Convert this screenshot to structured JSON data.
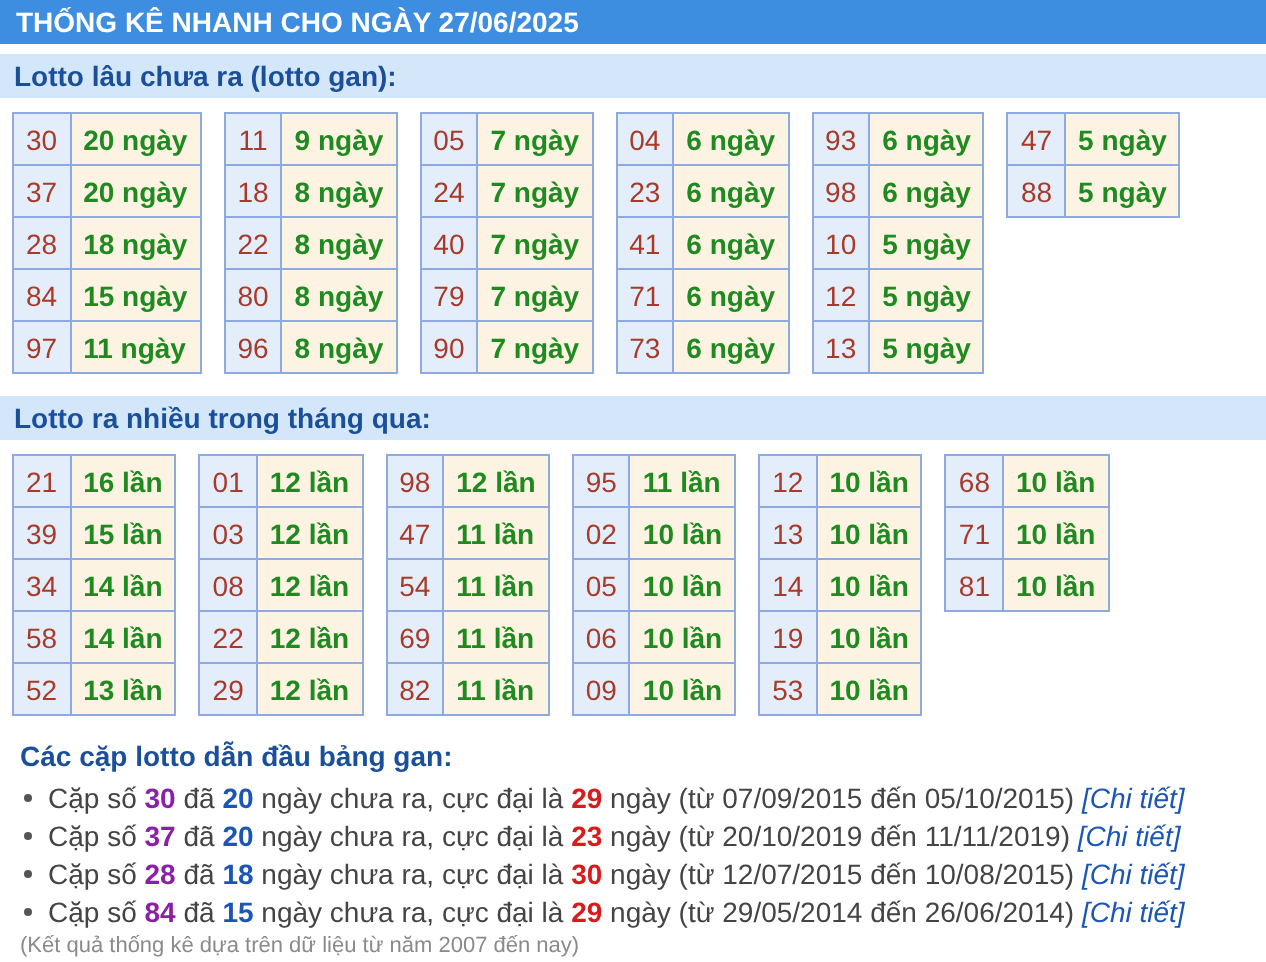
{
  "title": "THỐNG KÊ NHANH CHO NGÀY 27/06/2025",
  "sections": [
    {
      "heading": "Lotto lâu chưa ra (lotto gan):",
      "tables": [
        [
          {
            "number": "30",
            "value": "20 ngày"
          },
          {
            "number": "37",
            "value": "20 ngày"
          },
          {
            "number": "28",
            "value": "18 ngày"
          },
          {
            "number": "84",
            "value": "15 ngày"
          },
          {
            "number": "97",
            "value": "11 ngày"
          }
        ],
        [
          {
            "number": "11",
            "value": "9 ngày"
          },
          {
            "number": "18",
            "value": "8 ngày"
          },
          {
            "number": "22",
            "value": "8 ngày"
          },
          {
            "number": "80",
            "value": "8 ngày"
          },
          {
            "number": "96",
            "value": "8 ngày"
          }
        ],
        [
          {
            "number": "05",
            "value": "7 ngày"
          },
          {
            "number": "24",
            "value": "7 ngày"
          },
          {
            "number": "40",
            "value": "7 ngày"
          },
          {
            "number": "79",
            "value": "7 ngày"
          },
          {
            "number": "90",
            "value": "7 ngày"
          }
        ],
        [
          {
            "number": "04",
            "value": "6 ngày"
          },
          {
            "number": "23",
            "value": "6 ngày"
          },
          {
            "number": "41",
            "value": "6 ngày"
          },
          {
            "number": "71",
            "value": "6 ngày"
          },
          {
            "number": "73",
            "value": "6 ngày"
          }
        ],
        [
          {
            "number": "93",
            "value": "6 ngày"
          },
          {
            "number": "98",
            "value": "6 ngày"
          },
          {
            "number": "10",
            "value": "5 ngày"
          },
          {
            "number": "12",
            "value": "5 ngày"
          },
          {
            "number": "13",
            "value": "5 ngày"
          }
        ],
        [
          {
            "number": "47",
            "value": "5 ngày"
          },
          {
            "number": "88",
            "value": "5 ngày"
          }
        ]
      ]
    },
    {
      "heading": "Lotto ra nhiều trong tháng qua:",
      "tables": [
        [
          {
            "number": "21",
            "value": "16 lần"
          },
          {
            "number": "39",
            "value": "15 lần"
          },
          {
            "number": "34",
            "value": "14 lần"
          },
          {
            "number": "58",
            "value": "14 lần"
          },
          {
            "number": "52",
            "value": "13 lần"
          }
        ],
        [
          {
            "number": "01",
            "value": "12 lần"
          },
          {
            "number": "03",
            "value": "12 lần"
          },
          {
            "number": "08",
            "value": "12 lần"
          },
          {
            "number": "22",
            "value": "12 lần"
          },
          {
            "number": "29",
            "value": "12 lần"
          }
        ],
        [
          {
            "number": "98",
            "value": "12 lần"
          },
          {
            "number": "47",
            "value": "11 lần"
          },
          {
            "number": "54",
            "value": "11 lần"
          },
          {
            "number": "69",
            "value": "11 lần"
          },
          {
            "number": "82",
            "value": "11 lần"
          }
        ],
        [
          {
            "number": "95",
            "value": "11 lần"
          },
          {
            "number": "02",
            "value": "10 lần"
          },
          {
            "number": "05",
            "value": "10 lần"
          },
          {
            "number": "06",
            "value": "10 lần"
          },
          {
            "number": "09",
            "value": "10 lần"
          }
        ],
        [
          {
            "number": "12",
            "value": "10 lần"
          },
          {
            "number": "13",
            "value": "10 lần"
          },
          {
            "number": "14",
            "value": "10 lần"
          },
          {
            "number": "19",
            "value": "10 lần"
          },
          {
            "number": "53",
            "value": "10 lần"
          }
        ],
        [
          {
            "number": "68",
            "value": "10 lần"
          },
          {
            "number": "71",
            "value": "10 lần"
          },
          {
            "number": "81",
            "value": "10 lần"
          }
        ]
      ]
    }
  ],
  "summary": {
    "heading": "Các cặp lotto dẫn đầu bảng gan:",
    "items": [
      {
        "segments": [
          {
            "kind": "text",
            "text": "Cặp số "
          },
          {
            "kind": "pair",
            "text": "30"
          },
          {
            "kind": "text",
            "text": " đã "
          },
          {
            "kind": "days",
            "text": "20"
          },
          {
            "kind": "text",
            "text": " ngày chưa ra, cực đại là "
          },
          {
            "kind": "max",
            "text": "29"
          },
          {
            "kind": "text",
            "text": " ngày (từ 07/09/2015 đến 05/10/2015) "
          }
        ],
        "link": "[Chi tiết]"
      },
      {
        "segments": [
          {
            "kind": "text",
            "text": "Cặp số "
          },
          {
            "kind": "pair",
            "text": "37"
          },
          {
            "kind": "text",
            "text": " đã "
          },
          {
            "kind": "days",
            "text": "20"
          },
          {
            "kind": "text",
            "text": " ngày chưa ra, cực đại là "
          },
          {
            "kind": "max",
            "text": "23"
          },
          {
            "kind": "text",
            "text": " ngày (từ 20/10/2019 đến 11/11/2019) "
          }
        ],
        "link": "[Chi tiết]"
      },
      {
        "segments": [
          {
            "kind": "text",
            "text": "Cặp số "
          },
          {
            "kind": "pair",
            "text": "28"
          },
          {
            "kind": "text",
            "text": " đã "
          },
          {
            "kind": "days",
            "text": "18"
          },
          {
            "kind": "text",
            "text": " ngày chưa ra, cực đại là "
          },
          {
            "kind": "max",
            "text": "30"
          },
          {
            "kind": "text",
            "text": " ngày (từ 12/07/2015 đến 10/08/2015) "
          }
        ],
        "link": "[Chi tiết]"
      },
      {
        "segments": [
          {
            "kind": "text",
            "text": "Cặp số "
          },
          {
            "kind": "pair",
            "text": "84"
          },
          {
            "kind": "text",
            "text": " đã "
          },
          {
            "kind": "days",
            "text": "15"
          },
          {
            "kind": "text",
            "text": " ngày chưa ra, cực đại là "
          },
          {
            "kind": "max",
            "text": "29"
          },
          {
            "kind": "text",
            "text": " ngày (từ 29/05/2014 đến 26/06/2014) "
          }
        ],
        "link": "[Chi tiết]"
      }
    ],
    "note": "(Kết quả thống kê dựa trên dữ liệu từ năm 2007 đến nay)"
  }
}
